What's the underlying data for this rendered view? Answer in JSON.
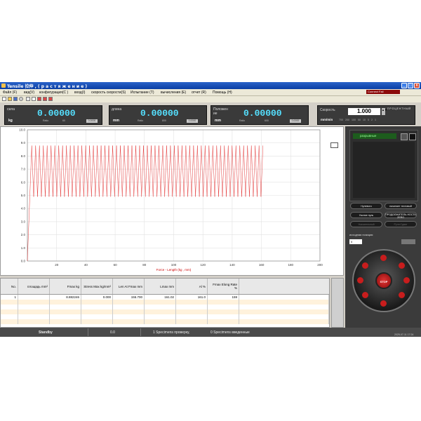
{
  "window": {
    "title": "Tensile 拉伸 , ( р а с т я ж е н и е )",
    "connection": "Connect Fail"
  },
  "menu": [
    {
      "label": "Файл (F)"
    },
    {
      "label": "вид(V)"
    },
    {
      "label": "конфигурация(C )"
    },
    {
      "label": "вход(I)"
    },
    {
      "label": "скорость скорости(S)"
    },
    {
      "label": "Испытание (T)"
    },
    {
      "label": "вычисления (E)"
    },
    {
      "label": "отчет (R)"
    },
    {
      "label": "Помощь (H)"
    }
  ],
  "readouts": {
    "force": {
      "label": "сила",
      "value": "0.00000",
      "unit": "kg",
      "sub1": "Ratio",
      "sub2": "60",
      "btn": "0.0000"
    },
    "length": {
      "label": "длина",
      "value": "0.00000",
      "unit": "mm",
      "sub1": "Ratio",
      "sub2": "800",
      "btn": "0.0000"
    },
    "position": {
      "label": "Положен ие",
      "value": "0.00000",
      "unit": "mm",
      "sub1": "Ratio",
      "sub2": "600",
      "btn": "0.0000"
    },
    "speed": {
      "label": "Скорость",
      "value": "1.000",
      "unit": "mm/min",
      "side": "П Р О Ц Е Н Т Н Ы Й",
      "scale": [
        "700",
        "200",
        "100",
        "50",
        "10",
        "5",
        "2",
        "1"
      ]
    }
  },
  "chart_data": {
    "type": "line",
    "title": "",
    "xlabel": "Force - Length   (kg , mm)",
    "ylabel": "",
    "xlim": [
      0,
      200
    ],
    "ylim": [
      0,
      10
    ],
    "xticks": [
      "20",
      "40",
      "60",
      "80",
      "100",
      "120",
      "140",
      "160",
      "180",
      "200"
    ],
    "yticks": [
      "0.0",
      "1.0",
      "2.0",
      "3.0",
      "4.0",
      "5.0",
      "6.0",
      "7.0",
      "8.0",
      "9.0",
      "10.0"
    ],
    "grid": true,
    "series": [
      {
        "color": "#e02020",
        "description": "oscillating force",
        "x_start": 0,
        "ramp_end_x": 3,
        "x_end": 161,
        "upper": 8.8,
        "lower": 4.9
      }
    ]
  },
  "right_panel": {
    "tab": "разрывные",
    "buttons": [
      "Нулевого",
      "начинает тестовый",
      "Усилие нуль",
      "ПРОДОЛЖИТЕЛЬ НОСТЬ ZERO",
      "Указательный",
      "Ручн.Сдвиг"
    ],
    "start_label": "исходная позиция",
    "start_value": "0",
    "stop": "STOP"
  },
  "table": {
    "headers": [
      "No.",
      "площадь mm²",
      "Fmax kg",
      "Stress Max kg/mm²",
      "Len At Fmax mm",
      "Lmax mm",
      "Al %",
      "Fmax Elong Rate %"
    ],
    "rows": [
      [
        "1",
        "",
        "8.882246",
        "0.000",
        "155.700",
        "161.02",
        "161.0",
        "159"
      ]
    ]
  },
  "status": {
    "state": "Standby",
    "value": "0.0",
    "info1": "1 Specimens проверку,",
    "info2": "0 Specimens введенные"
  },
  "clock": "2025-07-11 17:24"
}
